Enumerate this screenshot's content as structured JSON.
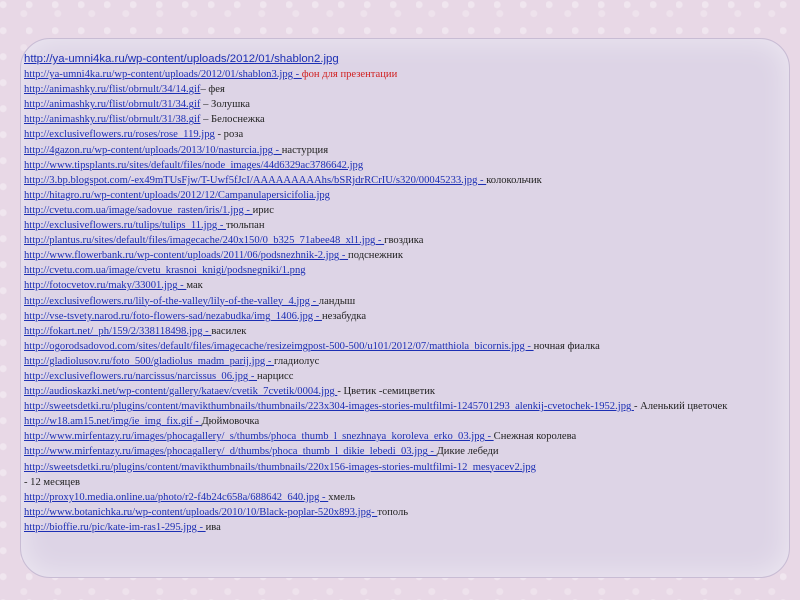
{
  "rows": [
    {
      "link": "http://ya-umni4ka.ru/wp-content/uploads/2012/01/shablon2.jpg",
      "desc": ""
    },
    {
      "link": "http://ya-umni4ka.ru/wp-content/uploads/2012/01/shablon3.jpg - ",
      "desc": "фон для презентации"
    },
    {
      "link": "http://animashky.ru/flist/obrnult/34/14.gif",
      "desc": "– фея"
    },
    {
      "link": "http://animashky.ru/flist/obrnult/31/34.gif",
      "desc": " – Золушка"
    },
    {
      "link": "http://animashky.ru/flist/obrnult/31/38.gif",
      "desc": " – Белоснежка"
    },
    {
      "link": " http://exclusiveflowers.ru/roses/rose_119.jpg",
      "desc": "  - роза"
    },
    {
      "link": "http://4gazon.ru/wp-content/uploads/2013/10/nasturcia.jpg - ",
      "desc": "настурция"
    },
    {
      "link": "http://www.tipsplants.ru/sites/default/files/node_images/44d6329ac3786642.jpg",
      "desc": ""
    },
    {
      "link": "http://3.bp.blogspot.com/-ex49mTUsFjw/T-Uwf5fJcI/AAAAAAAAAhs/bSRjdrRCrIU/s320/00045233.jpg  - ",
      "desc": "колокольчик"
    },
    {
      "link": "http://hitagro.ru/wp-content/uploads/2012/12/Campanulapersicifolia.jpg",
      "desc": ""
    },
    {
      "link": "http://cvetu.com.ua/image/sadovue_rasten/iris/1.jpg - ",
      "desc": "ирис"
    },
    {
      "link": "http://exclusiveflowers.ru/tulips/tulips_11.jpg - ",
      "desc": "тюльпан"
    },
    {
      "link": "http://plantus.ru/sites/default/files/imagecache/240x150/0_b325_71abee48_xl1.jpg - ",
      "desc": "гвоздика"
    },
    {
      "link": "http://www.flowerbank.ru/wp-content/uploads/2011/06/podsnezhnik-2.jpg - ",
      "desc": " подснежник"
    },
    {
      "link": "http://cvetu.com.ua/image/cvetu_krasnoi_knigi/podsnegniki/1.png",
      "desc": ""
    },
    {
      "link": "http://fotocvetov.ru/maky/33001.jpg - ",
      "desc": "мак"
    },
    {
      "link": "http://exclusiveflowers.ru/lily-of-the-valley/lily-of-the-valley_4.jpg - ",
      "desc": "ландыш"
    },
    {
      "link": "http://vse-tsvety.narod.ru/foto-flowers-sad/nezabudka/img_1406.jpg - ",
      "desc": "незабудка"
    },
    {
      "link": "http://fokart.net/_ph/159/2/338118498.jpg - ",
      "desc": "василек"
    },
    {
      "link": "http://ogorodsadovod.com/sites/default/files/imagecache/resizeimgpost-500-500/u101/2012/07/matthiola_bicornis.jpg - ",
      "desc": "ночная фиалка"
    },
    {
      "link": "http://gladiolusov.ru/foto_500/gladiolus_madm_parij.jpg - ",
      "desc": "гладиолус"
    },
    {
      "link": "http://exclusiveflowers.ru/narcissus/narcissus_06.jpg - ",
      "desc": "нарцисс"
    },
    {
      "link": "http://audioskazki.net/wp-content/gallery/kataev/cvetik_7cvetik/0004.jpg ",
      "desc": " - Цветик -семицветик"
    },
    {
      "link": "http://sweetsdetki.ru/plugins/content/mavikthumbnails/thumbnails/223x304-images-stories-multfilmi-1245701293_alenkij-cvetochek-1952.jpg ",
      "desc": " - Аленький цветочек",
      "wrap": true
    },
    {
      "link": "http://w18.am15.net/img/ie_img_fix.gif - ",
      "desc": "Дюймовочка"
    },
    {
      "link": "http://www.mirfentazy.ru/images/phocagallery/_s/thumbs/phoca_thumb_l_snezhnaya_koroleva_erko_03.jpg - ",
      "desc": "Снежная королева"
    },
    {
      "link": " http://www.mirfentazy.ru/images/phocagallery/_d/thumbs/phoca_thumb_l_dikie_lebedi_03.jpg - ",
      "desc": "Дикие лебеди"
    },
    {
      "link": "http://sweetsdetki.ru/plugins/content/mavikthumbnails/thumbnails/220x156-images-stories-multfilmi-12_mesyacev2.jpg",
      "desc": ""
    },
    {
      "link": "",
      "desc": "- 12 месяцев"
    },
    {
      "link": "http://proxy10.media.online.ua/photo/r2-f4b24c658a/688642_640.jpg - ",
      "desc": " хмель"
    },
    {
      "link": "http://www.botanichka.ru/wp-content/uploads/2010/10/Black-poplar-520x893.jpg- ",
      "desc": "тополь"
    },
    {
      "link": "http://bioffie.ru/pic/kate-im-ras1-295.jpg - ",
      "desc": "ива"
    }
  ],
  "colors": {
    "link": "#1c2fb4",
    "desc_highlight": "#d02020"
  }
}
